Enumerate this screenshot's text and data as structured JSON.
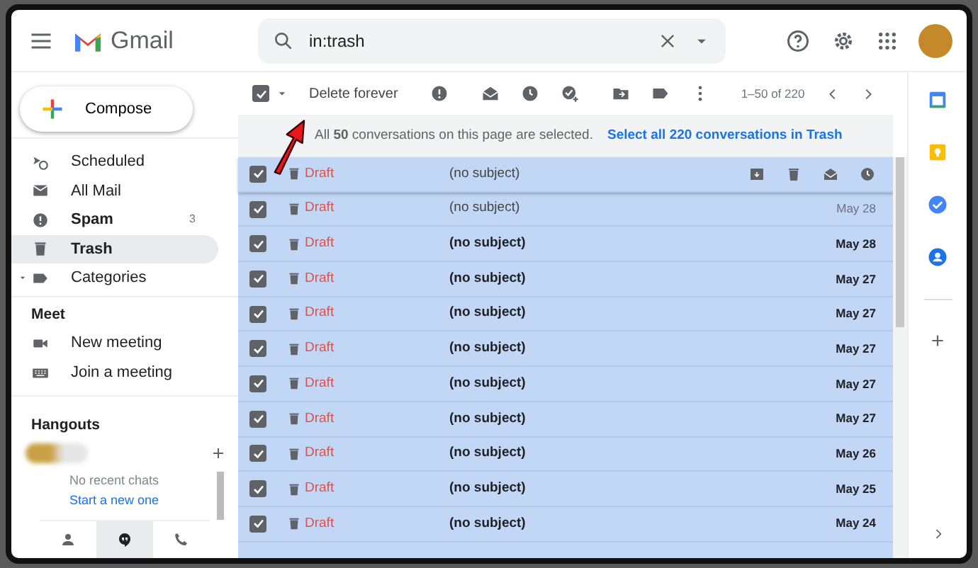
{
  "header": {
    "app_name": "Gmail",
    "search": {
      "value": "in:trash"
    }
  },
  "compose": {
    "label": "Compose"
  },
  "sidebar": {
    "items": [
      {
        "kind": "scheduled",
        "label": "Scheduled",
        "unread": false,
        "selected": false
      },
      {
        "kind": "all_mail",
        "label": "All Mail",
        "unread": false,
        "selected": false
      },
      {
        "kind": "spam",
        "label": "Spam",
        "count": "3",
        "unread": true,
        "selected": false
      },
      {
        "kind": "trash",
        "label": "Trash",
        "unread": false,
        "selected": true
      },
      {
        "kind": "categories",
        "label": "Categories",
        "unread": false,
        "selected": false
      }
    ],
    "meet": {
      "title": "Meet",
      "items": [
        {
          "kind": "video",
          "label": "New meeting"
        },
        {
          "kind": "keyboard",
          "label": "Join a meeting"
        }
      ]
    },
    "hangouts": {
      "title": "Hangouts",
      "empty_text": "No recent chats",
      "link": "Start a new one",
      "tabs": [
        {
          "kind": "person",
          "selected": false
        },
        {
          "kind": "hangouts",
          "selected": true
        },
        {
          "kind": "phone",
          "selected": false
        }
      ]
    }
  },
  "toolbar": {
    "select_all_checked": true,
    "delete_label": "Delete forever",
    "pagination": "1–50 of 220"
  },
  "banner": {
    "text": "All **50** conversations on this page are selected.",
    "link": "Select all 220 conversations in Trash"
  },
  "messages": [
    {
      "sender": "Draft",
      "subject": "(no subject)",
      "unread": false,
      "checked": true,
      "hovered": true
    },
    {
      "sender": "Draft",
      "subject": "(no subject)",
      "date": "May 28",
      "unread": false,
      "checked": true,
      "hovered": false
    },
    {
      "sender": "Draft",
      "subject": "(no subject)",
      "date": "May 28",
      "unread": true,
      "checked": true,
      "hovered": false
    },
    {
      "sender": "Draft",
      "subject": "(no subject)",
      "date": "May 27",
      "unread": true,
      "checked": true,
      "hovered": false
    },
    {
      "sender": "Draft",
      "subject": "(no subject)",
      "date": "May 27",
      "unread": true,
      "checked": true,
      "hovered": false
    },
    {
      "sender": "Draft",
      "subject": "(no subject)",
      "date": "May 27",
      "unread": true,
      "checked": true,
      "hovered": false
    },
    {
      "sender": "Draft",
      "subject": "(no subject)",
      "date": "May 27",
      "unread": true,
      "checked": true,
      "hovered": false
    },
    {
      "sender": "Draft",
      "subject": "(no subject)",
      "date": "May 27",
      "unread": true,
      "checked": true,
      "hovered": false
    },
    {
      "sender": "Draft",
      "subject": "(no subject)",
      "date": "May 26",
      "unread": true,
      "checked": true,
      "hovered": false
    },
    {
      "sender": "Draft",
      "subject": "(no subject)",
      "date": "May 25",
      "unread": true,
      "checked": true,
      "hovered": false
    },
    {
      "sender": "Draft",
      "subject": "(no subject)",
      "date": "May 24",
      "unread": true,
      "checked": true,
      "hovered": false
    }
  ],
  "annotation": {
    "kind": "arrow"
  }
}
